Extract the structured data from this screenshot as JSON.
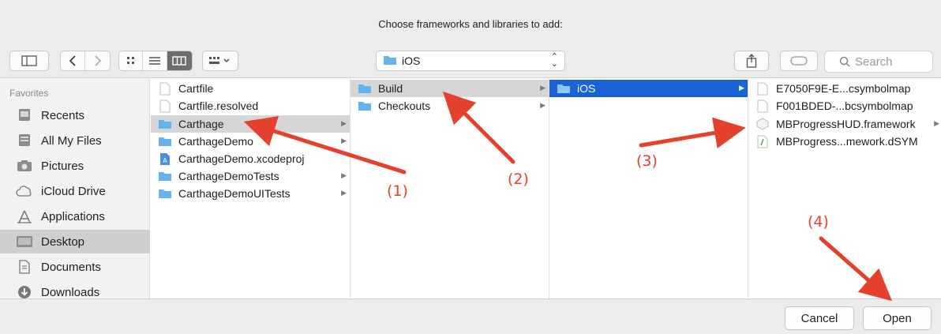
{
  "dialog": {
    "title": "Choose frameworks and libraries to add:"
  },
  "toolbar": {
    "path_label": "iOS",
    "search_placeholder": "Search"
  },
  "sidebar": {
    "heading": "Favorites",
    "items": [
      {
        "label": "Recents",
        "icon": "recents-icon"
      },
      {
        "label": "All My Files",
        "icon": "all-files-icon"
      },
      {
        "label": "Pictures",
        "icon": "camera-icon"
      },
      {
        "label": "iCloud Drive",
        "icon": "cloud-icon"
      },
      {
        "label": "Applications",
        "icon": "applications-icon"
      },
      {
        "label": "Desktop",
        "icon": "desktop-icon",
        "selected": true
      },
      {
        "label": "Documents",
        "icon": "documents-icon"
      },
      {
        "label": "Downloads",
        "icon": "downloads-icon"
      }
    ]
  },
  "columns": {
    "col1": [
      {
        "label": "Cartfile",
        "type": "file"
      },
      {
        "label": "Cartfile.resolved",
        "type": "file"
      },
      {
        "label": "Carthage",
        "type": "folder",
        "selected": true
      },
      {
        "label": "CarthageDemo",
        "type": "folder"
      },
      {
        "label": "CarthageDemo.xcodeproj",
        "type": "xcodeproj"
      },
      {
        "label": "CarthageDemoTests",
        "type": "folder"
      },
      {
        "label": "CarthageDemoUITests",
        "type": "folder"
      }
    ],
    "col2": [
      {
        "label": "Build",
        "type": "folder",
        "selected": true
      },
      {
        "label": "Checkouts",
        "type": "folder"
      }
    ],
    "col3": [
      {
        "label": "iOS",
        "type": "folder",
        "selected": true
      }
    ],
    "col4": [
      {
        "label": "E7050F9E-E...csymbolmap",
        "type": "file"
      },
      {
        "label": "F001BDED-...bcsymbolmap",
        "type": "file"
      },
      {
        "label": "MBProgressHUD.framework",
        "type": "framework"
      },
      {
        "label": "MBProgress...mework.dSYM",
        "type": "dsym"
      }
    ]
  },
  "footer": {
    "cancel_label": "Cancel",
    "open_label": "Open"
  },
  "annotations": {
    "a1": "(1)",
    "a2": "(2)",
    "a3": "(3)",
    "a4": "(4)"
  },
  "colors": {
    "selection_blue": "#1a63d6",
    "annotation_red": "#e4412c",
    "folder_blue": "#64b3ec"
  }
}
